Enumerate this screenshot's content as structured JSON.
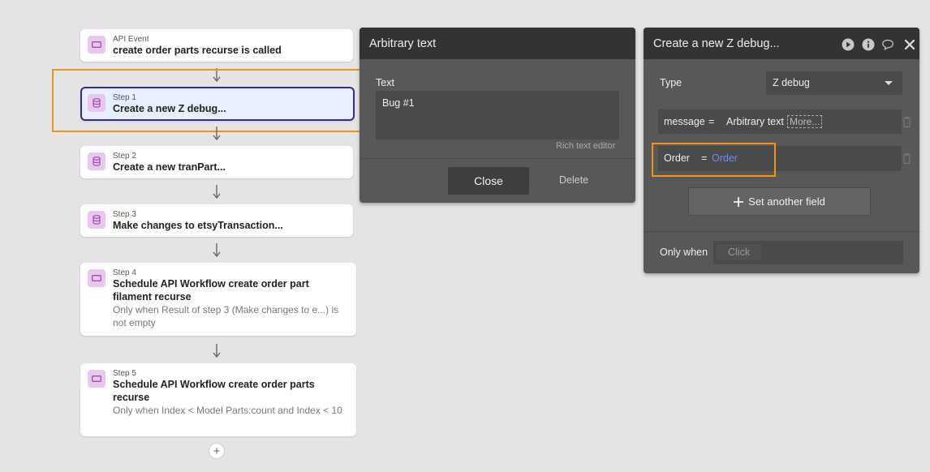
{
  "workflow": {
    "event": {
      "small": "API Event",
      "title": "create order parts recurse is called"
    },
    "steps": [
      {
        "small": "Step 1",
        "title": "Create a new Z debug..."
      },
      {
        "small": "Step 2",
        "title": "Create a new tranPart..."
      },
      {
        "small": "Step 3",
        "title": "Make changes to etsyTransaction..."
      },
      {
        "small": "Step 4",
        "title": "Schedule API Workflow create order part filament recurse",
        "condition": "Only when Result of step 3 (Make changes to e...) is not empty"
      },
      {
        "small": "Step 5",
        "title": "Schedule API Workflow create order parts recurse",
        "condition": "Only when Index < Model Parts:count and Index < 10"
      }
    ],
    "add_symbol": "+"
  },
  "text_editor": {
    "header_title": "Arbitrary text",
    "text_label": "Text",
    "text_value": "Bug #1",
    "rich_text_link": "Rich text editor",
    "close_label": "Close",
    "delete_label": "Delete"
  },
  "action_panel": {
    "header_title": "Create a new Z debug...",
    "type_label": "Type",
    "type_value": "Z debug",
    "fields": [
      {
        "name": "message",
        "eq": "=",
        "value": "Arbitrary text",
        "more": "More..."
      },
      {
        "name": "Order",
        "eq": "=",
        "value": "Order"
      }
    ],
    "set_field_label": "Set another field",
    "only_when_label": "Only when",
    "only_when_placeholder": "Click"
  },
  "colors": {
    "highlight_orange": "#f0921c",
    "selected_border": "#3a2a8c",
    "order_value_blue": "#6f8cf5",
    "step_icon_bg": "#e8c8ef"
  },
  "icons": [
    "event-icon",
    "database-icon",
    "schedule-icon",
    "arrow-down-icon",
    "play-icon",
    "info-icon",
    "comment-icon",
    "close-icon",
    "trash-icon",
    "chevron-down-icon",
    "plus-icon"
  ]
}
